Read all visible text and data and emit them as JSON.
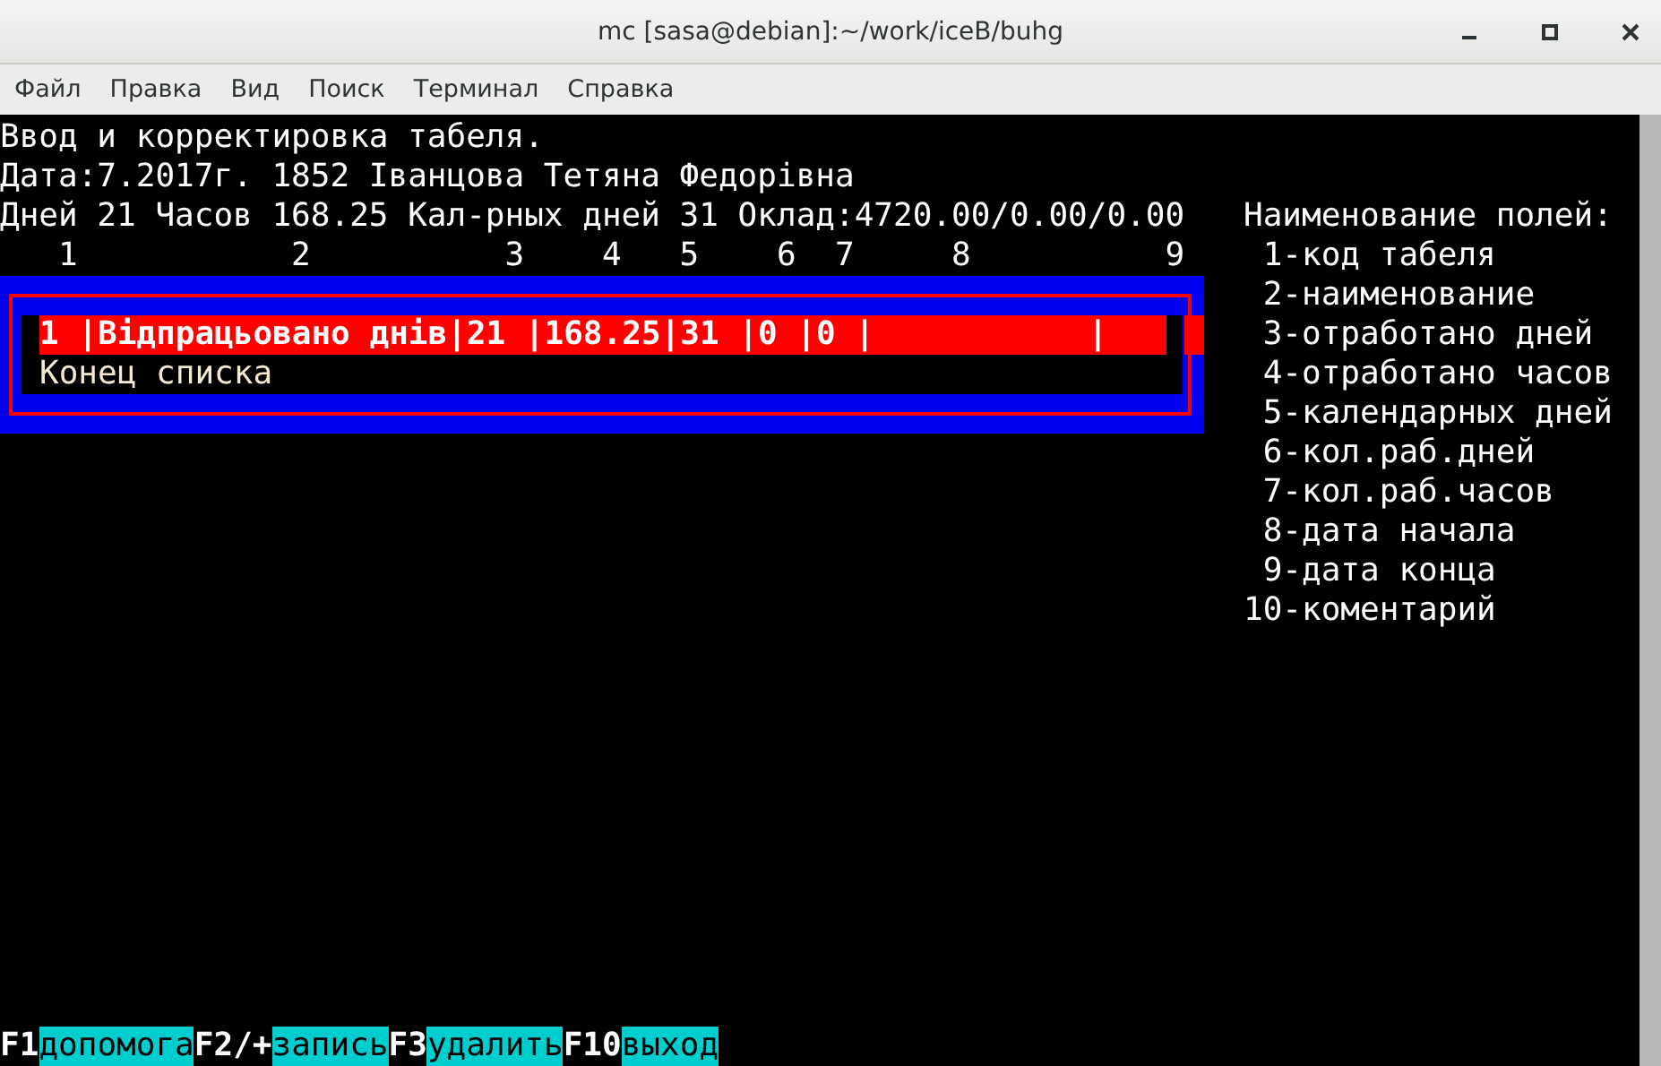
{
  "window": {
    "title": "mc [sasa@debian]:~/work/iceB/buhg"
  },
  "menu": [
    "Файл",
    "Правка",
    "Вид",
    "Поиск",
    "Терминал",
    "Справка"
  ],
  "header_lines": [
    "Ввод и корректировка табеля.",
    "Дата:7.2017г. 1852 Іванцова Тетяна Федорівна",
    "Дней 21 Часов 168.25 Кал-рных дней 31 Оклад:4720.00/0.00/0.00"
  ],
  "column_numbers": "   1           2          3    4   5    6  7     8          9",
  "records": [
    {
      "text": "1 |Відпрацьовано днів|21 |168.25|31 |0 |0 |           |",
      "selected": true
    }
  ],
  "end_of_list": "Конец списка",
  "legend": {
    "title": "Наименование полей:",
    "items": [
      " 1-код табеля",
      " 2-наименование",
      " 3-отработано дней",
      " 4-отработано часов",
      " 5-календарных дней",
      " 6-кол.раб.дней",
      " 7-кол.раб.часов",
      " 8-дата начала",
      " 9-дата конца",
      "10-коментарий"
    ]
  },
  "function_keys": [
    {
      "key": "F1",
      "label": "допомога"
    },
    {
      "key": "F2/+",
      "label": "запись"
    },
    {
      "key": "F3",
      "label": "удалить"
    },
    {
      "key": "F10",
      "label": "выход"
    }
  ]
}
